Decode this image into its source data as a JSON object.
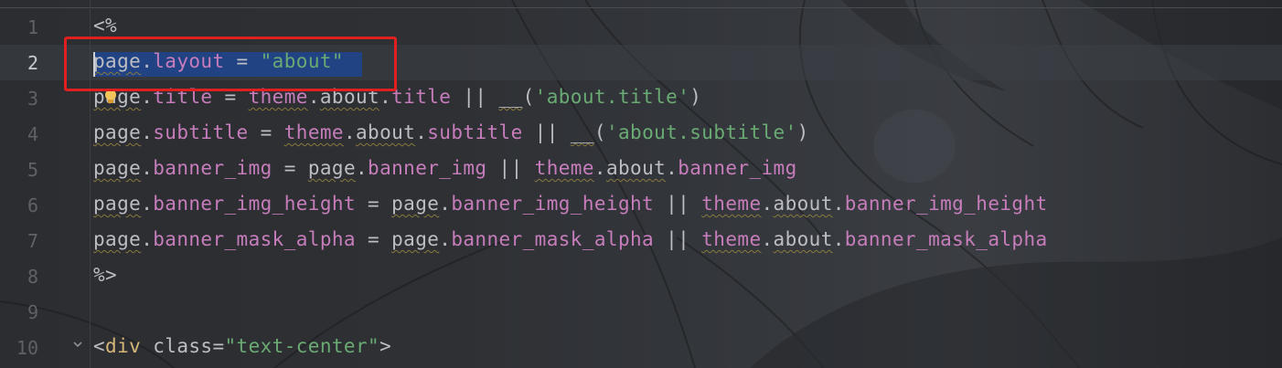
{
  "editor": {
    "line_numbers": [
      "1",
      "2",
      "3",
      "4",
      "5",
      "6",
      "7",
      "8",
      "9",
      "10"
    ],
    "active_line": "2",
    "lines": [
      {
        "tokens": [
          {
            "t": "<%",
            "c": "op"
          }
        ]
      },
      {
        "tokens": [
          {
            "t": "page",
            "c": "kw-obj"
          },
          {
            "t": ".",
            "c": "op"
          },
          {
            "t": "layout",
            "c": "prop"
          },
          {
            "t": " = ",
            "c": "op"
          },
          {
            "t": "\"about\"",
            "c": "str"
          }
        ]
      },
      {
        "tokens": [
          {
            "t": "page",
            "c": "kw-obj"
          },
          {
            "t": ".",
            "c": "op"
          },
          {
            "t": "title",
            "c": "prop"
          },
          {
            "t": " = ",
            "c": "op"
          },
          {
            "t": "theme",
            "c": "prop"
          },
          {
            "t": ".",
            "c": "op"
          },
          {
            "t": "about",
            "c": "kw-obj"
          },
          {
            "t": ".",
            "c": "op"
          },
          {
            "t": "title",
            "c": "prop"
          },
          {
            "t": " || ",
            "c": "op"
          },
          {
            "t": "__",
            "c": "kw-obj"
          },
          {
            "t": "(",
            "c": "op"
          },
          {
            "t": "'about.title'",
            "c": "str"
          },
          {
            "t": ")",
            "c": "op"
          }
        ]
      },
      {
        "tokens": [
          {
            "t": "page",
            "c": "kw-obj"
          },
          {
            "t": ".",
            "c": "op"
          },
          {
            "t": "subtitle",
            "c": "prop"
          },
          {
            "t": " = ",
            "c": "op"
          },
          {
            "t": "theme",
            "c": "prop"
          },
          {
            "t": ".",
            "c": "op"
          },
          {
            "t": "about",
            "c": "kw-obj"
          },
          {
            "t": ".",
            "c": "op"
          },
          {
            "t": "subtitle",
            "c": "prop"
          },
          {
            "t": " || ",
            "c": "op"
          },
          {
            "t": "__",
            "c": "kw-obj"
          },
          {
            "t": "(",
            "c": "op"
          },
          {
            "t": "'about.subtitle'",
            "c": "str"
          },
          {
            "t": ")",
            "c": "op"
          }
        ]
      },
      {
        "tokens": [
          {
            "t": "page",
            "c": "kw-obj"
          },
          {
            "t": ".",
            "c": "op"
          },
          {
            "t": "banner_img",
            "c": "prop"
          },
          {
            "t": " = ",
            "c": "op"
          },
          {
            "t": "page",
            "c": "kw-obj"
          },
          {
            "t": ".",
            "c": "op"
          },
          {
            "t": "banner_img",
            "c": "prop"
          },
          {
            "t": " || ",
            "c": "op"
          },
          {
            "t": "theme",
            "c": "prop"
          },
          {
            "t": ".",
            "c": "op"
          },
          {
            "t": "about",
            "c": "kw-obj"
          },
          {
            "t": ".",
            "c": "op"
          },
          {
            "t": "banner_img",
            "c": "prop"
          }
        ]
      },
      {
        "tokens": [
          {
            "t": "page",
            "c": "kw-obj"
          },
          {
            "t": ".",
            "c": "op"
          },
          {
            "t": "banner_img_height",
            "c": "prop"
          },
          {
            "t": " = ",
            "c": "op"
          },
          {
            "t": "page",
            "c": "kw-obj"
          },
          {
            "t": ".",
            "c": "op"
          },
          {
            "t": "banner_img_height",
            "c": "prop"
          },
          {
            "t": " || ",
            "c": "op"
          },
          {
            "t": "theme",
            "c": "prop"
          },
          {
            "t": ".",
            "c": "op"
          },
          {
            "t": "about",
            "c": "kw-obj"
          },
          {
            "t": ".",
            "c": "op"
          },
          {
            "t": "banner_img_height",
            "c": "prop"
          }
        ]
      },
      {
        "tokens": [
          {
            "t": "page",
            "c": "kw-obj"
          },
          {
            "t": ".",
            "c": "op"
          },
          {
            "t": "banner_mask_alpha",
            "c": "prop"
          },
          {
            "t": " = ",
            "c": "op"
          },
          {
            "t": "page",
            "c": "kw-obj"
          },
          {
            "t": ".",
            "c": "op"
          },
          {
            "t": "banner_mask_alpha",
            "c": "prop"
          },
          {
            "t": " || ",
            "c": "op"
          },
          {
            "t": "theme",
            "c": "prop"
          },
          {
            "t": ".",
            "c": "op"
          },
          {
            "t": "about",
            "c": "kw-obj"
          },
          {
            "t": ".",
            "c": "op"
          },
          {
            "t": "banner_mask_alpha",
            "c": "prop"
          }
        ]
      },
      {
        "tokens": [
          {
            "t": "%>",
            "c": "op"
          }
        ]
      },
      {
        "tokens": []
      },
      {
        "tokens": [
          {
            "t": "<",
            "c": "op"
          },
          {
            "t": "div",
            "c": "tag"
          },
          {
            "t": " ",
            "c": "op"
          },
          {
            "t": "class",
            "c": "attr"
          },
          {
            "t": "=",
            "c": "op"
          },
          {
            "t": "\"text-center\"",
            "c": "str"
          },
          {
            "t": ">",
            "c": "op"
          }
        ]
      }
    ],
    "colors": {
      "property": "#c77dbb",
      "string": "#6aab73",
      "tag": "#d5b778",
      "text": "#bcbec4",
      "selection": "#214283",
      "highlight_box": "#e02020"
    },
    "icons": [
      "intention-bulb-icon",
      "fold-chevron-icon"
    ]
  }
}
